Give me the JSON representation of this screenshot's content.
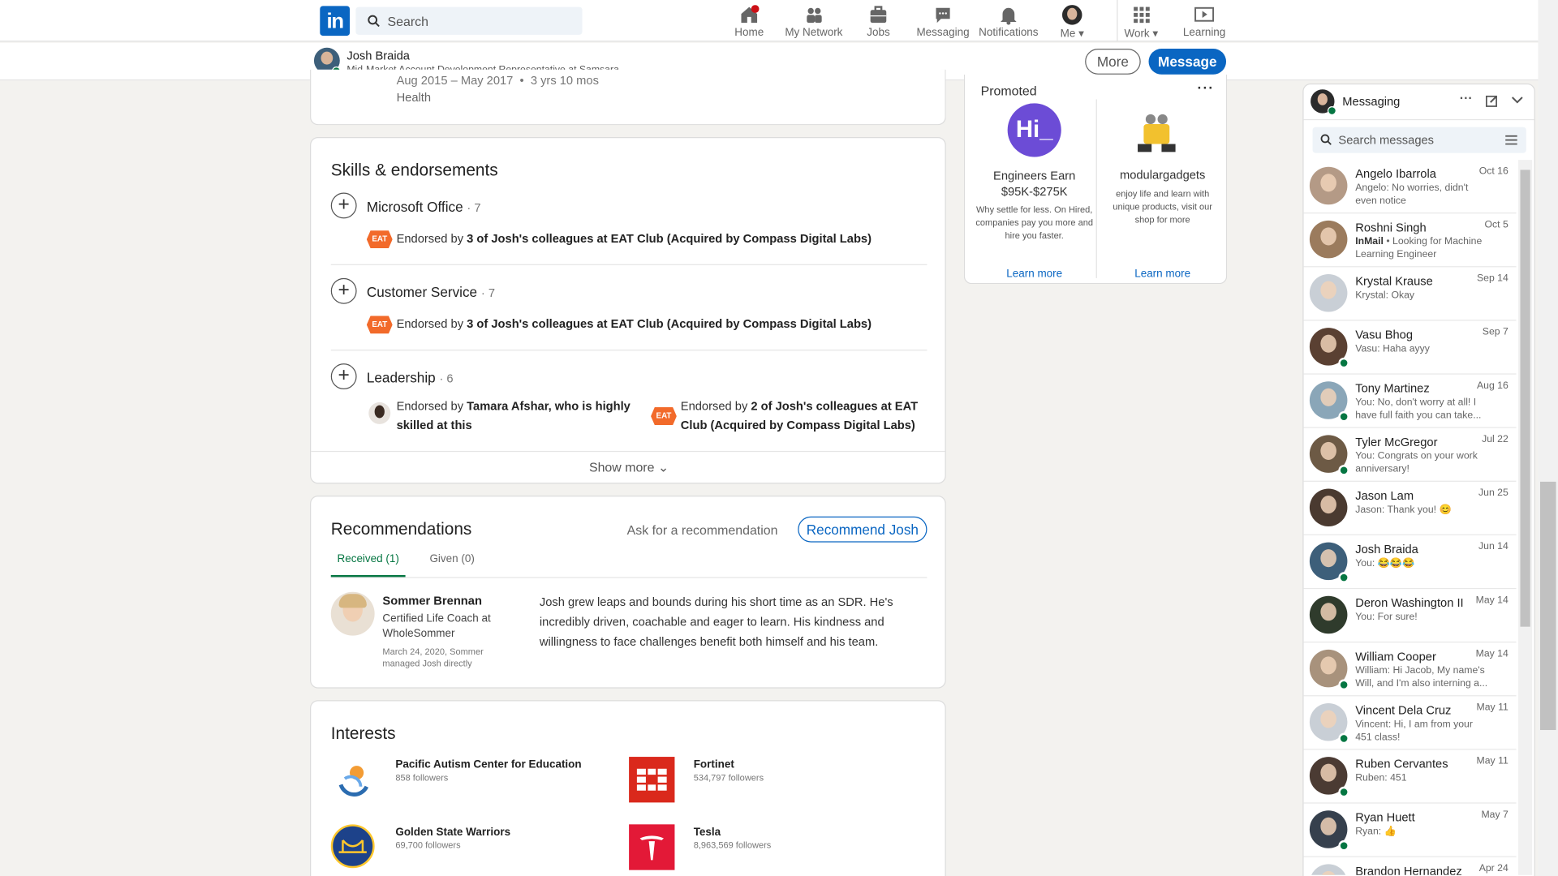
{
  "nav": {
    "logo": "in",
    "search_placeholder": "Search",
    "items": [
      {
        "label": "Home",
        "icon": "home-icon"
      },
      {
        "label": "My Network",
        "icon": "network-icon"
      },
      {
        "label": "Jobs",
        "icon": "jobs-icon"
      },
      {
        "label": "Messaging",
        "icon": "messaging-icon"
      },
      {
        "label": "Notifications",
        "icon": "notifications-icon"
      },
      {
        "label": "Me",
        "icon": "me-avatar"
      },
      {
        "label": "Work",
        "icon": "grid-icon"
      },
      {
        "label": "Learning",
        "icon": "learning-icon"
      }
    ]
  },
  "subbar": {
    "name": "Josh Braida",
    "headline": "Mid-Market Account Development Representative at Samsara",
    "more_label": "More",
    "message_label": "Message"
  },
  "experience": {
    "dates": "Aug 2015 – May 2017  •  3 yrs 10 mos",
    "category": "Health"
  },
  "skills": {
    "title": "Skills & endorsements",
    "items": [
      {
        "name": "Microsoft Office",
        "count": "· 7",
        "endorsement_prefix": "Endorsed by ",
        "endorsement_bold": "3 of Josh's colleagues at EAT Club (Acquired by Compass Digital Labs)"
      },
      {
        "name": "Customer Service",
        "count": "· 7",
        "endorsement_prefix": "Endorsed by ",
        "endorsement_bold": "3 of Josh's colleagues at EAT Club (Acquired by Compass Digital Labs)"
      },
      {
        "name": "Leadership",
        "count": "· 6",
        "endorsement_prefix": "Endorsed by ",
        "endorsement_bold": "Tamara Afshar, who is highly skilled at this",
        "endorsement2_prefix": "Endorsed by ",
        "endorsement2_bold": "2 of Josh's colleagues at EAT Club (Acquired by Compass Digital Labs)"
      }
    ],
    "eat_logo": "EAT",
    "show_more": "Show more"
  },
  "recommendations": {
    "title": "Recommendations",
    "ask_label": "Ask for a recommendation",
    "recommend_label": "Recommend Josh",
    "tabs": [
      "Received (1)",
      "Given (0)"
    ],
    "item": {
      "name": "Sommer Brennan",
      "title": "Certified Life Coach at WholeSommer",
      "meta": "March 24, 2020, Sommer managed Josh directly",
      "text": "Josh grew leaps and bounds during his short time as an SDR. He's incredibly driven, coachable and eager to learn. His kindness and willingness to face challenges benefit both himself and his team."
    }
  },
  "interests": {
    "title": "Interests",
    "items": [
      {
        "name": "Pacific Autism Center for Education",
        "followers": "858 followers"
      },
      {
        "name": "Fortinet",
        "followers": "534,797 followers"
      },
      {
        "name": "Golden State Warriors",
        "followers": "69,700 followers"
      },
      {
        "name": "Tesla",
        "followers": "8,963,569 followers"
      }
    ]
  },
  "promoted": {
    "label": "Promoted",
    "ads": [
      {
        "logo_text": "Hi_",
        "title": "Engineers Earn $95K-$275K",
        "desc": "Why settle for less. On Hired, companies pay you more and hire you faster.",
        "cta": "Learn more"
      },
      {
        "title": "modulargadgets",
        "desc": "enjoy life and learn with unique products, visit our shop for more",
        "cta": "Learn more"
      }
    ]
  },
  "messaging": {
    "title": "Messaging",
    "search_placeholder": "Search messages",
    "threads": [
      {
        "name": "Angelo Ibarrola",
        "date": "Oct 16",
        "preview": "Angelo: No worries, didn't even notice",
        "online": false,
        "color": "#b49a86"
      },
      {
        "name": "Roshni Singh",
        "date": "Oct 5",
        "preview_bold": "InMail",
        "preview": " • Looking for Machine Learning Engineer",
        "online": false,
        "color": "#9b7b5d"
      },
      {
        "name": "Krystal Krause",
        "date": "Sep 14",
        "preview": "Krystal: Okay",
        "online": false,
        "color": "#c9cfd6"
      },
      {
        "name": "Vasu Bhog",
        "date": "Sep 7",
        "preview": "Vasu: Haha ayyy",
        "online": true,
        "color": "#5a4032"
      },
      {
        "name": "Tony Martinez",
        "date": "Aug 16",
        "preview": "You: No, don't worry at all! I have full faith you can take...",
        "online": true,
        "color": "#8aa6b8"
      },
      {
        "name": "Tyler McGregor",
        "date": "Jul 22",
        "preview": "You: Congrats on your work anniversary!",
        "online": true,
        "color": "#6d5a45"
      },
      {
        "name": "Jason Lam",
        "date": "Jun 25",
        "preview": "Jason: Thank you! 😊",
        "online": false,
        "color": "#4a3a30"
      },
      {
        "name": "Josh Braida",
        "date": "Jun 14",
        "preview": "You: 😂😂😂",
        "online": true,
        "color": "#3d5f7a"
      },
      {
        "name": "Deron Washington II",
        "date": "May 14",
        "preview": "You: For sure!",
        "online": false,
        "color": "#2f3b2c"
      },
      {
        "name": "William Cooper",
        "date": "May 14",
        "preview": "William: Hi Jacob, My name's Will, and I'm also interning a...",
        "online": true,
        "color": "#a8927c"
      },
      {
        "name": "Vincent Dela Cruz",
        "date": "May 11",
        "preview": "Vincent: Hi, I am from your 451 class!",
        "online": true,
        "color": "#c9cfd6"
      },
      {
        "name": "Ruben Cervantes",
        "date": "May 11",
        "preview": "Ruben: 451",
        "online": true,
        "color": "#4b3b33"
      },
      {
        "name": "Ryan Huett",
        "date": "May 7",
        "preview": "Ryan: 👍",
        "online": true,
        "color": "#36404d"
      },
      {
        "name": "Brandon Hernandez",
        "date": "Apr 24",
        "preview": "",
        "online": false,
        "color": "#c9cfd6"
      }
    ]
  }
}
